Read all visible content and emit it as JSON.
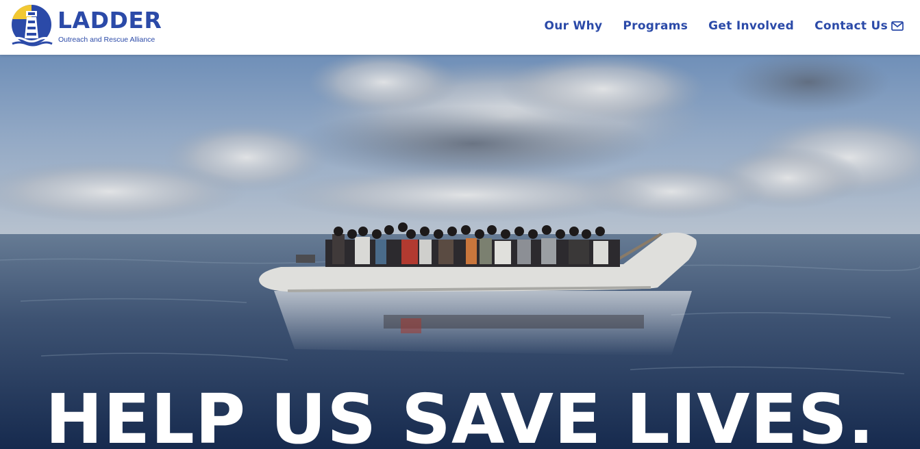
{
  "brand": {
    "name": "LADDER",
    "tagline": "Outreach and Rescue Alliance",
    "colors": {
      "primary": "#2b4aa8",
      "accent": "#f2c832"
    }
  },
  "nav": {
    "items": [
      {
        "label": "Our Why"
      },
      {
        "label": "Programs"
      },
      {
        "label": "Get Involved"
      },
      {
        "label": "Contact Us",
        "icon": "envelope-icon"
      }
    ]
  },
  "hero": {
    "image": "inflatable-boat-at-sea-photo",
    "headline": "HELP US SAVE LIVES."
  }
}
